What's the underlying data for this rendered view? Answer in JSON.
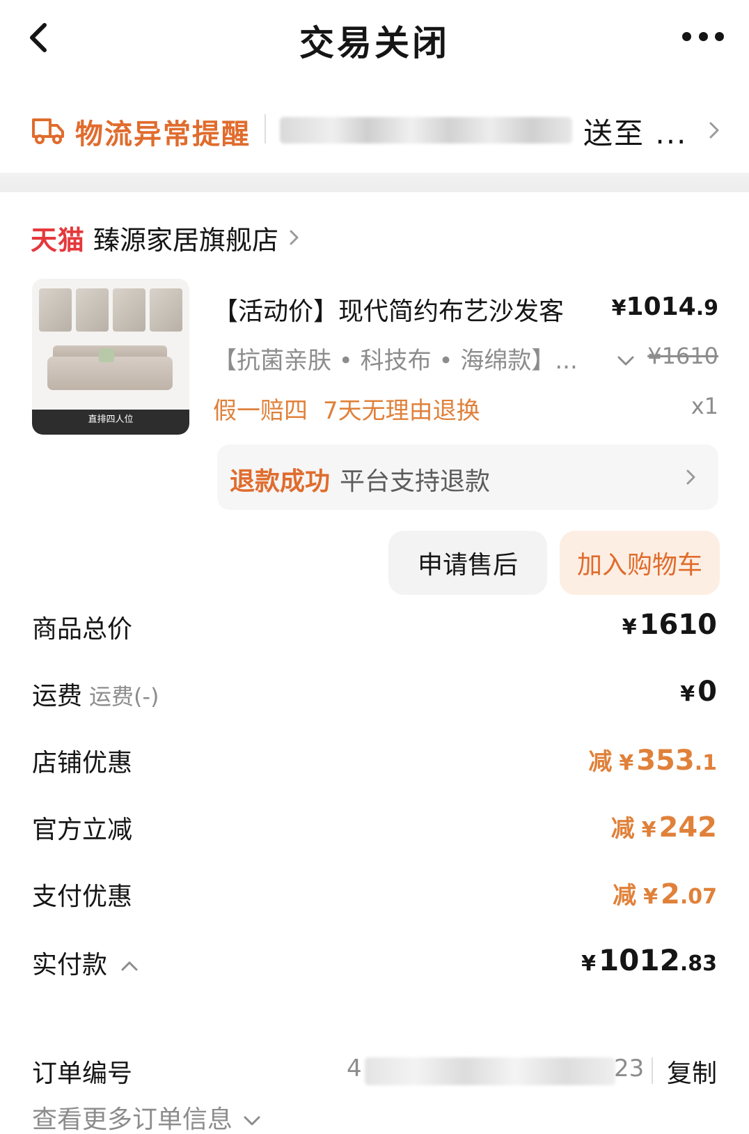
{
  "header": {
    "title": "交易关闭"
  },
  "logistics": {
    "label": "物流异常提醒",
    "text": "送至 ..."
  },
  "shop": {
    "brand": "天猫",
    "name": "臻源家居旗舰店"
  },
  "product": {
    "title": "【活动价】现代简约布艺沙发客",
    "price_currency": "¥",
    "price_int": "1014",
    "price_dec": ".9",
    "spec": "【抗菌亲肤 • 科技布 • 海绵款】...",
    "original_price": "¥1610",
    "guarantee_1": "假一赔四",
    "guarantee_2": "7天无理由退换",
    "quantity": "x1",
    "image_caption": "直排四人位"
  },
  "refund": {
    "status": "退款成功",
    "desc": "平台支持退款"
  },
  "actions": {
    "after_sale": "申请售后",
    "add_cart": "加入购物车"
  },
  "summary": {
    "total": {
      "label": "商品总价",
      "currency": "¥",
      "int": "1610",
      "dec": ""
    },
    "shipping": {
      "label": "运费",
      "sub": "运费(-)",
      "currency": "¥",
      "int": "0",
      "dec": ""
    },
    "shop_discount": {
      "label": "店铺优惠",
      "prefix": "减",
      "currency": "¥",
      "int": "353",
      "dec": ".1"
    },
    "official_discount": {
      "label": "官方立减",
      "prefix": "减",
      "currency": "¥",
      "int": "242",
      "dec": ""
    },
    "payment_discount": {
      "label": "支付优惠",
      "prefix": "减",
      "currency": "¥",
      "int": "2",
      "dec": ".07"
    },
    "paid": {
      "label": "实付款",
      "currency": "¥",
      "int": "1012",
      "dec": ".83"
    }
  },
  "order": {
    "label": "订单编号",
    "number_prefix": "4",
    "number_suffix": "23",
    "copy": "复制",
    "more_info": "查看更多订单信息"
  },
  "colors": {
    "accent": "#e06c2d",
    "discount": "#e0813a",
    "tmall_red": "#e4393c",
    "muted": "#8c8c8c"
  },
  "icons": {
    "back": "chevron-left-icon",
    "more": "more-dots-icon",
    "logistics": "truck-icon",
    "chevron": "chevron-right-icon",
    "expand": "chevron-down-icon",
    "collapse": "chevron-up-icon"
  }
}
